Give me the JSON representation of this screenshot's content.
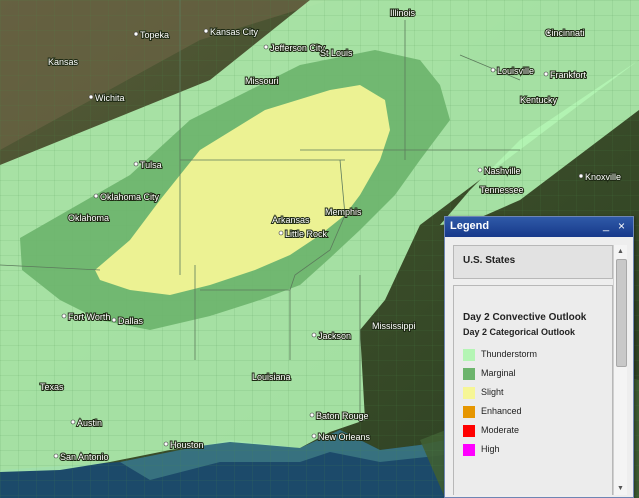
{
  "map": {
    "cities": [
      {
        "name": "Topeka"
      },
      {
        "name": "Kansas City"
      },
      {
        "name": "Illinois"
      },
      {
        "name": "Cincinnati"
      },
      {
        "name": "Jefferson City"
      },
      {
        "name": "St Louis"
      },
      {
        "name": "Kansas"
      },
      {
        "name": "Missouri"
      },
      {
        "name": "Wichita"
      },
      {
        "name": "Louisville"
      },
      {
        "name": "Frankfort"
      },
      {
        "name": "Kentucky"
      },
      {
        "name": "Tulsa"
      },
      {
        "name": "Nashville"
      },
      {
        "name": "Tennessee"
      },
      {
        "name": "Knoxville"
      },
      {
        "name": "Oklahoma City"
      },
      {
        "name": "Oklahoma"
      },
      {
        "name": "Memphis"
      },
      {
        "name": "Arkansas"
      },
      {
        "name": "Little Rock"
      },
      {
        "name": "Fort Worth"
      },
      {
        "name": "Dallas"
      },
      {
        "name": "Jackson"
      },
      {
        "name": "Mississippi"
      },
      {
        "name": "Texas"
      },
      {
        "name": "Louisiana"
      },
      {
        "name": "Austin"
      },
      {
        "name": "Baton Rouge"
      },
      {
        "name": "Houston"
      },
      {
        "name": "New Orleans"
      },
      {
        "name": "San Antonio"
      }
    ]
  },
  "legend": {
    "title": "Legend",
    "minimize": "_",
    "close": "×",
    "layers": [
      {
        "name": "U.S. States"
      },
      {
        "name": "Day 2 Convective Outlook",
        "subtitle": "Day 2 Categorical Outlook",
        "items": [
          {
            "label": "Thunderstorm",
            "color": "#b4f5b4"
          },
          {
            "label": "Marginal",
            "color": "#6cb46c"
          },
          {
            "label": "Slight",
            "color": "#f6f696"
          },
          {
            "label": "Enhanced",
            "color": "#e69600"
          },
          {
            "label": "Moderate",
            "color": "#ff0000"
          },
          {
            "label": "High",
            "color": "#ff00ff"
          }
        ]
      }
    ],
    "scroll_up": "▲",
    "scroll_down": "▼"
  },
  "colors": {
    "thunderstorm_fill": "#b4f5b4",
    "marginal_fill": "#6cb46c",
    "slight_fill": "#f6f696",
    "legend_header": "#2352a3"
  }
}
